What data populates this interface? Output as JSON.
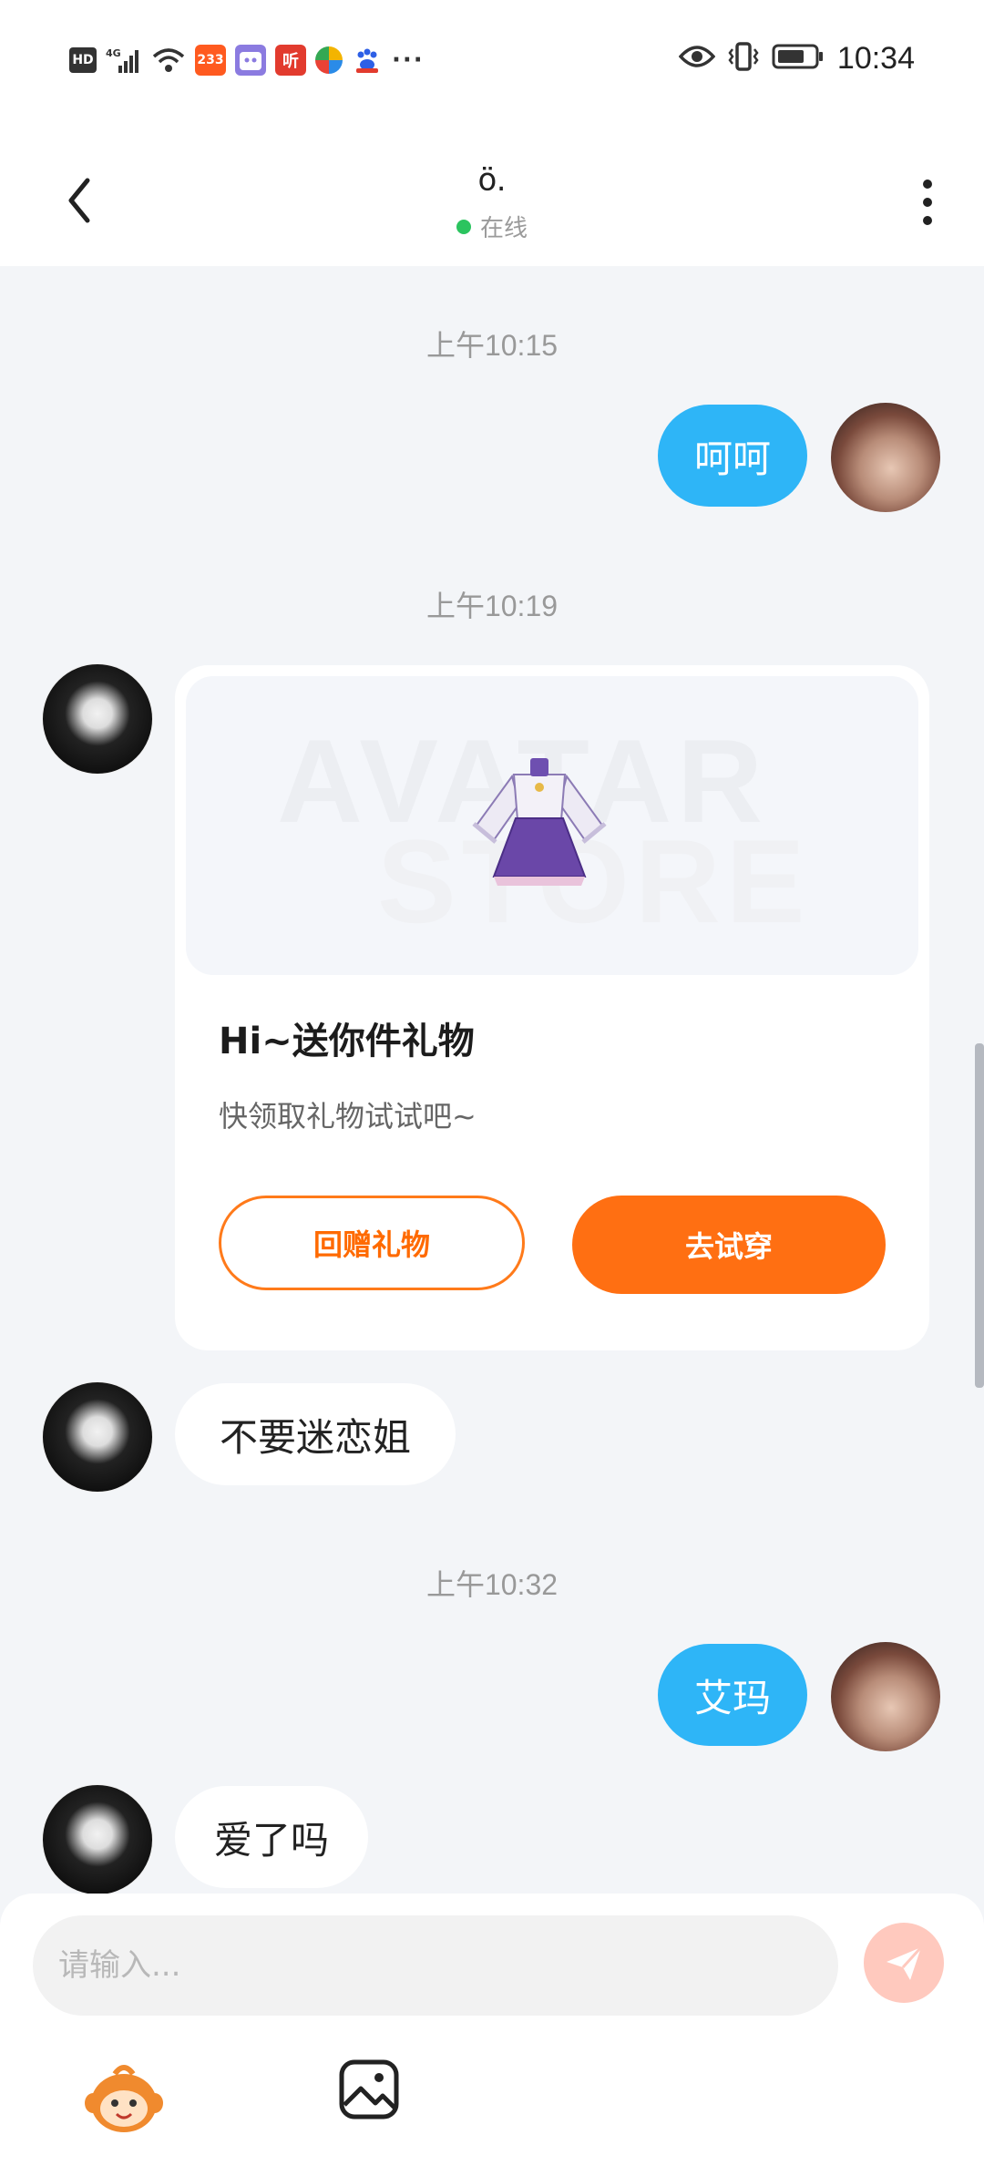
{
  "status_bar": {
    "hd": "HD",
    "network": "4G",
    "app_233": "233",
    "app_listen": "听",
    "more": "···",
    "time": "10:34"
  },
  "header": {
    "contact_name": "ö.",
    "status": "在线"
  },
  "messages": [
    {
      "type": "timestamp",
      "text": "上午10:15"
    },
    {
      "type": "text",
      "sender": "me",
      "text": "呵呵"
    },
    {
      "type": "timestamp",
      "text": "上午10:19"
    },
    {
      "type": "gift",
      "sender": "other",
      "watermark_top": "AVATAR",
      "watermark_bottom": "STORE",
      "title": "Hi~送你件礼物",
      "subtitle": "快领取礼物试试吧~",
      "return_label": "回赠礼物",
      "try_label": "去试穿"
    },
    {
      "type": "text",
      "sender": "other",
      "text": "不要迷恋姐"
    },
    {
      "type": "timestamp",
      "text": "上午10:32"
    },
    {
      "type": "text",
      "sender": "me",
      "text": "艾玛"
    },
    {
      "type": "text",
      "sender": "other",
      "text": "爱了吗"
    }
  ],
  "composer": {
    "placeholder": "请输入..."
  },
  "colors": {
    "accent_orange": "#FF6F12",
    "bubble_blue": "#2EB5F7",
    "online_green": "#2BC45F",
    "send_disabled": "#FFC9BE"
  },
  "icons": [
    "back-arrow-icon",
    "more-vertical-icon",
    "send-icon",
    "emoji-mascot-icon",
    "image-icon"
  ]
}
